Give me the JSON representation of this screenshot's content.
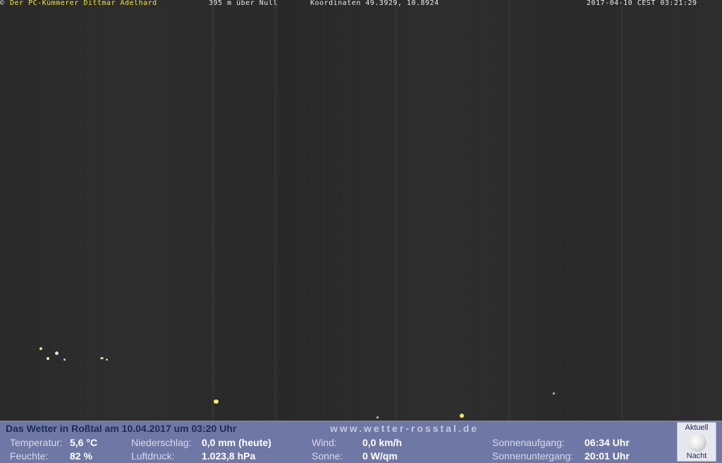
{
  "overlay": {
    "copyright": "©",
    "owner": "Der PC-Kümmerer Dittmar Adelhard",
    "altitude": "395 m über Null",
    "coordinates": "Koordinaten 49.3929, 10.8924",
    "timestamp": "2017-04-10 CEST 03:21:29"
  },
  "panel": {
    "title": "Das Wetter in Roßtal am 10.04.2017 um 03:20 Uhr",
    "url": "www.wetter-rosstal.de",
    "temperature": {
      "label": "Temperatur:",
      "value": "5,6 °C"
    },
    "humidity": {
      "label": "Feuchte:",
      "value": "82 %"
    },
    "precipitation": {
      "label": "Niederschlag:",
      "value": "0,0 mm (heute)"
    },
    "pressure": {
      "label": "Luftdruck:",
      "value": "1.023,8 hPa"
    },
    "wind": {
      "label": "Wind:",
      "value": "0,0 km/h"
    },
    "sun": {
      "label": "Sonne:",
      "value": "0 W/qm"
    },
    "sunrise": {
      "label": "Sonnenaufgang:",
      "value": "06:34 Uhr"
    },
    "sunset": {
      "label": "Sonnenuntergang:",
      "value": "20:01 Uhr"
    },
    "moon": {
      "top_label": "Aktuell",
      "bottom_label": "Nacht",
      "icon": "moon-icon"
    }
  },
  "colors": {
    "overlay_text": "#f2e23a",
    "panel_background": "#6f78a4",
    "panel_title": "#1d2b57"
  }
}
